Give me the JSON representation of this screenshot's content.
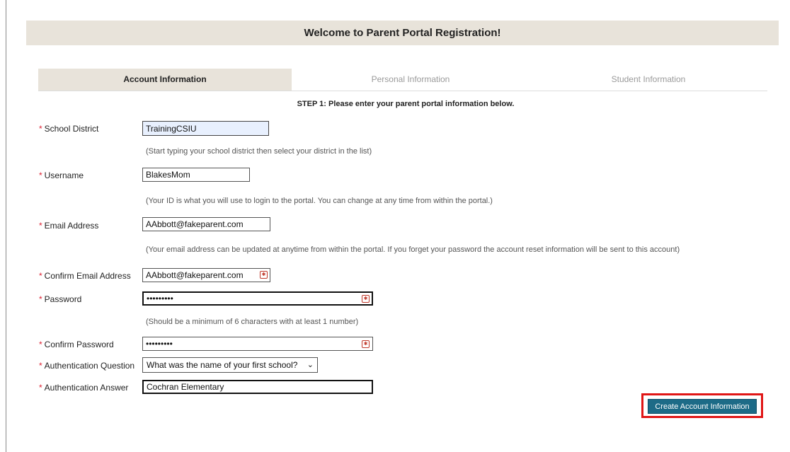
{
  "header": {
    "title": "Welcome to Parent Portal Registration!"
  },
  "tabs": [
    {
      "label": "Account Information"
    },
    {
      "label": "Personal Information"
    },
    {
      "label": "Student Information"
    }
  ],
  "step_text": "STEP 1: Please enter your parent portal information below.",
  "form": {
    "district_label": "School District",
    "district_value": "TrainingCSIU",
    "district_hint": "(Start typing your school district then select your district in the list)",
    "username_label": "Username",
    "username_value": "BlakesMom",
    "username_hint": "(Your ID is what you will use to login to the portal. You can change at any time from within the portal.)",
    "email_label": "Email Address",
    "email_value": "AAbbott@fakeparent.com",
    "email_hint": "(Your email address can be updated at anytime from within the portal. If you forget your password the account reset information will be sent to this account)",
    "confirm_email_label": "Confirm Email Address",
    "confirm_email_value": "AAbbott@fakeparent.com",
    "password_label": "Password",
    "password_value": "•••••••••",
    "password_hint": "(Should be a minimum of 6 characters with at least 1 number)",
    "confirm_password_label": "Confirm Password",
    "confirm_password_value": "•••••••••",
    "question_label": "Authentication Question",
    "question_value": "What was the name of your first school?",
    "answer_label": "Authentication Answer",
    "answer_value": "Cochran Elementary",
    "required_marker": "*"
  },
  "submit_label": "Create Account Information",
  "colors": {
    "header_bg": "#e8e3da",
    "button_bg": "#1d6b87",
    "highlight_border": "#e01616",
    "required": "#dd2233"
  }
}
